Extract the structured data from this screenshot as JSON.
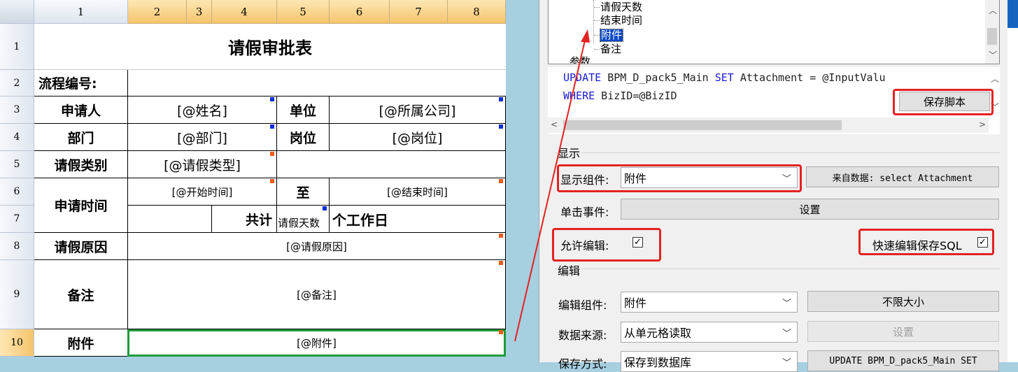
{
  "columns": [
    "1",
    "2",
    "3",
    "4",
    "5",
    "6",
    "7",
    "8"
  ],
  "rows": [
    "1",
    "2",
    "3",
    "4",
    "5",
    "6",
    "7",
    "8",
    "9",
    "10"
  ],
  "form": {
    "title": "请假审批表",
    "flow_no_label": "流程编号:",
    "applicant_label": "申请人",
    "applicant_value": "[@姓名]",
    "unit_label": "单位",
    "unit_value": "[@所属公司]",
    "dept_label": "部门",
    "dept_value": "[@部门]",
    "post_label": "岗位",
    "post_value": "[@岗位]",
    "leave_type_label": "请假类别",
    "leave_type_value": "[@请假类型]",
    "apply_time_label": "申请时间",
    "start_value": "[@开始时间]",
    "to_label": "至",
    "end_value": "[@结束时间]",
    "total_label": "共计",
    "days_value": "请假天数",
    "workday_label": "个工作日",
    "reason_label": "请假原因",
    "reason_value": "[@请假原因]",
    "note_label": "备注",
    "note_value": "[@备注]",
    "attach_label": "附件",
    "attach_value": "[@附件]"
  },
  "tree": {
    "items": [
      "请假天数",
      "结束时间",
      "附件",
      "备注",
      "参数"
    ],
    "selected": "附件"
  },
  "code": {
    "line1_kw1": "UPDATE",
    "line1_mid": " BPM_D_pack5_Main ",
    "line1_kw2": "SET",
    "line1_rest": " Attachment = @InputValu",
    "line2_kw": "WHERE",
    "line2_rest": " BizID=@BizID",
    "save_button": "保存脚本"
  },
  "display": {
    "group_title": "显示",
    "component_label": "显示组件:",
    "component_value": "附件",
    "source_button": "来自数据: select Attachment",
    "click_label": "单击事件:",
    "click_button": "设置",
    "allow_edit_label": "允许编辑:",
    "allow_edit_checked": true,
    "quick_save_label": "快速编辑保存SQL",
    "quick_save_checked": true
  },
  "edit": {
    "group_title": "编辑",
    "component_label": "编辑组件:",
    "component_value": "附件",
    "size_button": "不限大小",
    "source_label": "数据来源:",
    "source_value": "从单元格读取",
    "source_button": "设置",
    "save_label": "保存方式:",
    "save_value": "保存到数据库",
    "save_button": "UPDATE BPM_D_pack5_Main SET"
  },
  "colors": {
    "annotation": "#e52222",
    "selection_border": "#1e9b3b",
    "tree_highlight": "#0a48c7",
    "sql_keyword": "#1a1ad8",
    "marker_blue": "#0b2fd8",
    "marker_orange": "#f05a1a"
  }
}
